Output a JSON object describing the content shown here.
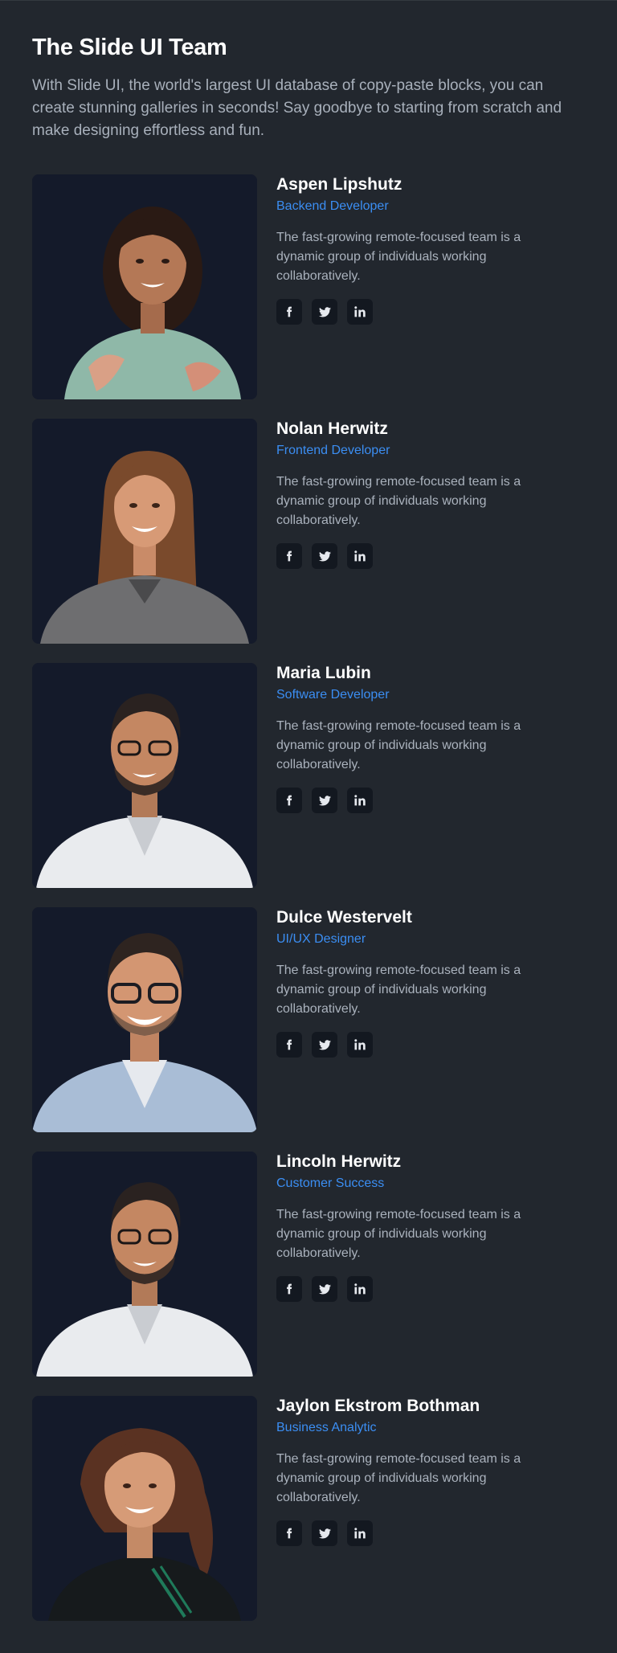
{
  "header": {
    "title": "The Slide UI Team",
    "intro": "With Slide UI, the world's largest UI database of copy-paste blocks, you can create stunning galleries in seconds! Say goodbye to starting from scratch and make designing effortless and fun."
  },
  "colors": {
    "background": "#22272e",
    "role_accent": "#3b8ef3",
    "photo_bg": "#141a2a",
    "social_bg": "#131820"
  },
  "social_icons": [
    "facebook-icon",
    "twitter-icon",
    "linkedin-icon"
  ],
  "members": [
    {
      "name": "Aspen Lipshutz",
      "role": "Backend Developer",
      "description": "The fast-growing remote-focused team is a dynamic group of individuals working collaboratively.",
      "photo": "portrait-woman-curly-hair-floral-shirt"
    },
    {
      "name": "Nolan Herwitz",
      "role": "Frontend Developer",
      "description": "The fast-growing remote-focused team is a dynamic group of individuals working collaboratively.",
      "photo": "portrait-woman-long-wavy-hair-gray-shirt"
    },
    {
      "name": "Maria Lubin",
      "role": "Software Developer",
      "description": "The fast-growing remote-focused team is a dynamic group of individuals working collaboratively.",
      "photo": "portrait-man-glasses-beard-white-shirt"
    },
    {
      "name": "Dulce Westervelt",
      "role": "UI/UX Designer",
      "description": "The fast-growing remote-focused team is a dynamic group of individuals working collaboratively.",
      "photo": "portrait-man-glasses-smiling-denim-shirt"
    },
    {
      "name": "Lincoln Herwitz",
      "role": "Customer Success",
      "description": "The fast-growing remote-focused team is a dynamic group of individuals working collaboratively.",
      "photo": "portrait-man-glasses-beard-white-shirt"
    },
    {
      "name": "Jaylon Ekstrom Bothman",
      "role": "Business Analytic",
      "description": "The fast-growing remote-focused team is a dynamic group of individuals working collaboratively.",
      "photo": "portrait-woman-ponytail-dark-jacket"
    }
  ]
}
